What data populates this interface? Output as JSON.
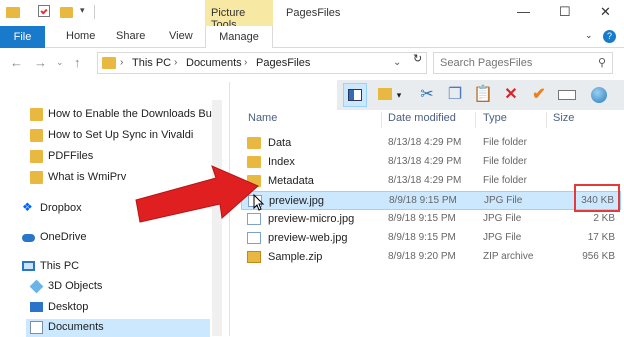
{
  "window": {
    "context_tab": "Picture Tools",
    "title": "PagesFiles",
    "min_glyph": "—",
    "max_glyph": "☐",
    "close_glyph": "✕"
  },
  "ribbon": {
    "tabs": [
      "File",
      "Home",
      "Share",
      "View",
      "Manage"
    ]
  },
  "address": {
    "crumbs": [
      "This PC",
      "Documents",
      "PagesFiles"
    ],
    "search_placeholder": "Search PagesFiles"
  },
  "nav": {
    "items": [
      {
        "label": "How to Enable the Downloads Butt",
        "icon": "folder-icon"
      },
      {
        "label": "How to Set Up Sync in Vivaldi",
        "icon": "folder-icon"
      },
      {
        "label": "PDFFiles",
        "icon": "folder-icon"
      },
      {
        "label": "What is WmiPrv",
        "icon": "folder-icon"
      },
      {
        "label": "Dropbox",
        "icon": "dropbox-icon"
      },
      {
        "label": "OneDrive",
        "icon": "onedrive-icon"
      },
      {
        "label": "This PC",
        "icon": "computer-icon"
      },
      {
        "label": "3D Objects",
        "icon": "cube-icon"
      },
      {
        "label": "Desktop",
        "icon": "desktop-icon"
      },
      {
        "label": "Documents",
        "icon": "documents-icon"
      }
    ]
  },
  "columns": {
    "name": "Name",
    "date": "Date modified",
    "type": "Type",
    "size": "Size"
  },
  "files": [
    {
      "name": "Data",
      "date": "8/13/18 4:29 PM",
      "type": "File folder",
      "size": "",
      "kind": "folder"
    },
    {
      "name": "Index",
      "date": "8/13/18 4:29 PM",
      "type": "File folder",
      "size": "",
      "kind": "folder"
    },
    {
      "name": "Metadata",
      "date": "8/13/18 4:29 PM",
      "type": "File folder",
      "size": "",
      "kind": "folder"
    },
    {
      "name": "preview.jpg",
      "date": "8/9/18 9:15 PM",
      "type": "JPG File",
      "size": "340 KB",
      "kind": "jpg"
    },
    {
      "name": "preview-micro.jpg",
      "date": "8/9/18 9:15 PM",
      "type": "JPG File",
      "size": "2 KB",
      "kind": "jpg"
    },
    {
      "name": "preview-web.jpg",
      "date": "8/9/18 9:15 PM",
      "type": "JPG File",
      "size": "17 KB",
      "kind": "jpg"
    },
    {
      "name": "Sample.zip",
      "date": "8/9/18 9:20 PM",
      "type": "ZIP archive",
      "size": "956 KB",
      "kind": "zip"
    }
  ],
  "colors": {
    "file_tab": "#1979ca",
    "selection": "#cce8ff",
    "highlight": "#e53a3a",
    "arrow": "#e02020"
  }
}
